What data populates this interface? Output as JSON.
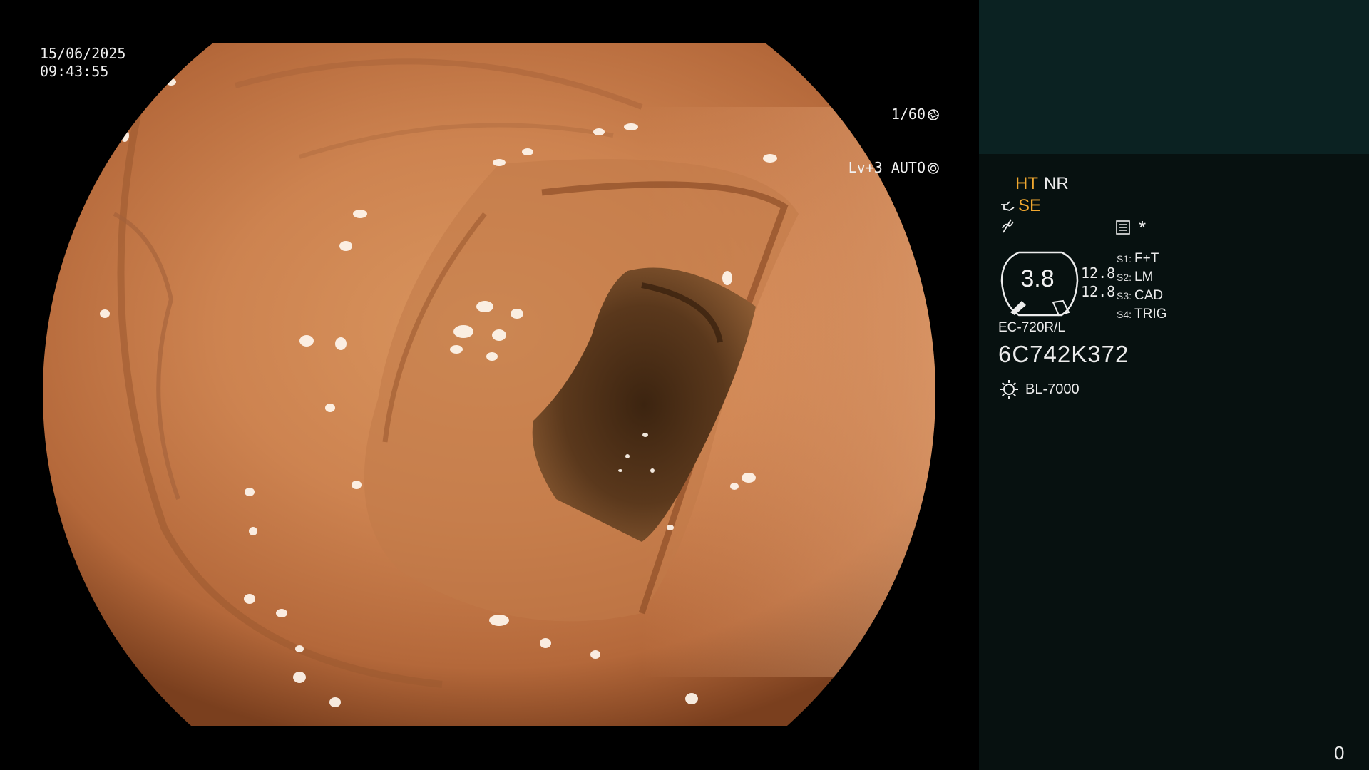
{
  "overlay": {
    "date": "15/06/2025",
    "time": "09:43:55",
    "shutter_speed": "1/60",
    "iris": "Lv+3 AUTO",
    "icons": [
      "shutter-icon",
      "iris-icon"
    ]
  },
  "sidebar": {
    "mode_ht": "HT",
    "mode_nr": "NR",
    "mode_se": "SE",
    "zoom": "3.8",
    "zoom_values": [
      "12.8",
      "12.8"
    ],
    "switches": [
      {
        "key": "S1:",
        "value": "F+T"
      },
      {
        "key": "S2:",
        "value": "LM"
      },
      {
        "key": "S3:",
        "value": "CAD"
      },
      {
        "key": "S4:",
        "value": "TRIG"
      }
    ],
    "star": "*",
    "scope_model": "EC-720R/L",
    "serial": "6C742K372",
    "light_source": "BL-7000",
    "counter": "0",
    "colors": {
      "accent": "#f0a830",
      "panel_top": "#0b2222",
      "panel": "#071110"
    },
    "icons": [
      "scope-icon",
      "enhancement-icon",
      "document-icon",
      "light-source-icon"
    ]
  }
}
